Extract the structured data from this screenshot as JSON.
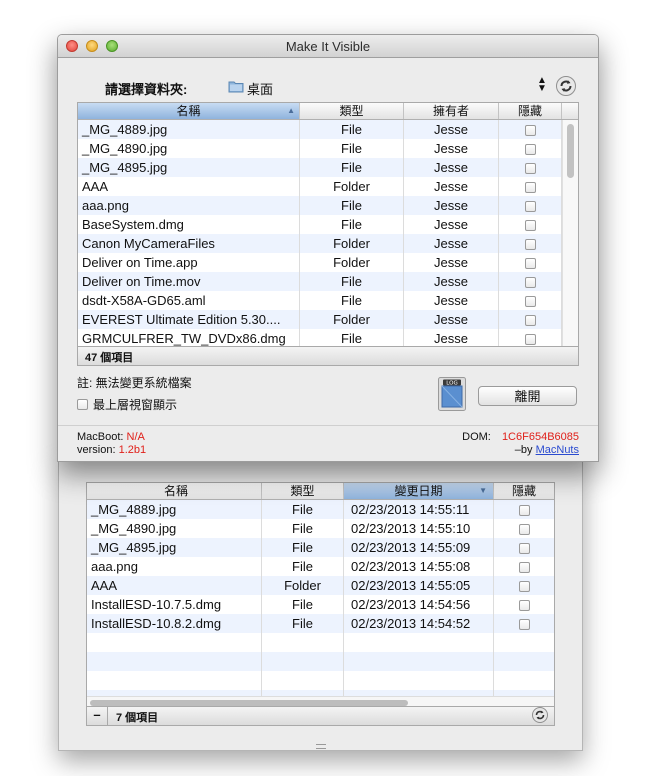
{
  "window": {
    "title": "Make It Visible"
  },
  "folder": {
    "label": "請選擇資料夾:",
    "name": "桌面"
  },
  "main_table": {
    "columns": [
      "名稱",
      "類型",
      "擁有者",
      "隱藏"
    ],
    "rows": [
      {
        "name": "_MG_4889.jpg",
        "type": "File",
        "owner": "Jesse"
      },
      {
        "name": "_MG_4890.jpg",
        "type": "File",
        "owner": "Jesse"
      },
      {
        "name": "_MG_4895.jpg",
        "type": "File",
        "owner": "Jesse"
      },
      {
        "name": "AAA",
        "type": "Folder",
        "owner": "Jesse"
      },
      {
        "name": "aaa.png",
        "type": "File",
        "owner": "Jesse"
      },
      {
        "name": "BaseSystem.dmg",
        "type": "File",
        "owner": "Jesse"
      },
      {
        "name": "Canon MyCameraFiles",
        "type": "Folder",
        "owner": "Jesse"
      },
      {
        "name": "Deliver on Time.app",
        "type": "Folder",
        "owner": "Jesse"
      },
      {
        "name": "Deliver on Time.mov",
        "type": "File",
        "owner": "Jesse"
      },
      {
        "name": "dsdt-X58A-GD65.aml",
        "type": "File",
        "owner": "Jesse"
      },
      {
        "name": "EVEREST Ultimate Edition 5.30....",
        "type": "Folder",
        "owner": "Jesse"
      },
      {
        "name": "GRMCULFRER_TW_DVDx86.dmg",
        "type": "File",
        "owner": "Jesse"
      }
    ],
    "count_label": "47 個項目"
  },
  "note": "註: 無法變更系統檔案",
  "always_on_top_label": "最上層視窗顯示",
  "log_icon_label": "LOG",
  "leave_button": "離開",
  "info": {
    "macboot_label": "MacBoot:",
    "macboot_value": "N/A",
    "version_label": "version:",
    "version_value": "1.2b1",
    "dom_label": "DOM:",
    "dom_value": "1C6F654B6085",
    "by_label": "–by",
    "by_link": "MacNuts"
  },
  "hidden_table": {
    "columns": [
      "名稱",
      "類型",
      "變更日期",
      "隱藏"
    ],
    "rows": [
      {
        "name": "_MG_4889.jpg",
        "type": "File",
        "date": "02/23/2013 14:55:11"
      },
      {
        "name": "_MG_4890.jpg",
        "type": "File",
        "date": "02/23/2013 14:55:10"
      },
      {
        "name": "_MG_4895.jpg",
        "type": "File",
        "date": "02/23/2013 14:55:09"
      },
      {
        "name": "aaa.png",
        "type": "File",
        "date": "02/23/2013 14:55:08"
      },
      {
        "name": "AAA",
        "type": "Folder",
        "date": "02/23/2013 14:55:05"
      },
      {
        "name": "InstallESD-10.7.5.dmg",
        "type": "File",
        "date": "02/23/2013 14:54:56"
      },
      {
        "name": "InstallESD-10.8.2.dmg",
        "type": "File",
        "date": "02/23/2013 14:54:52"
      }
    ],
    "count_label": "7 個項目",
    "minus_label": "–"
  }
}
